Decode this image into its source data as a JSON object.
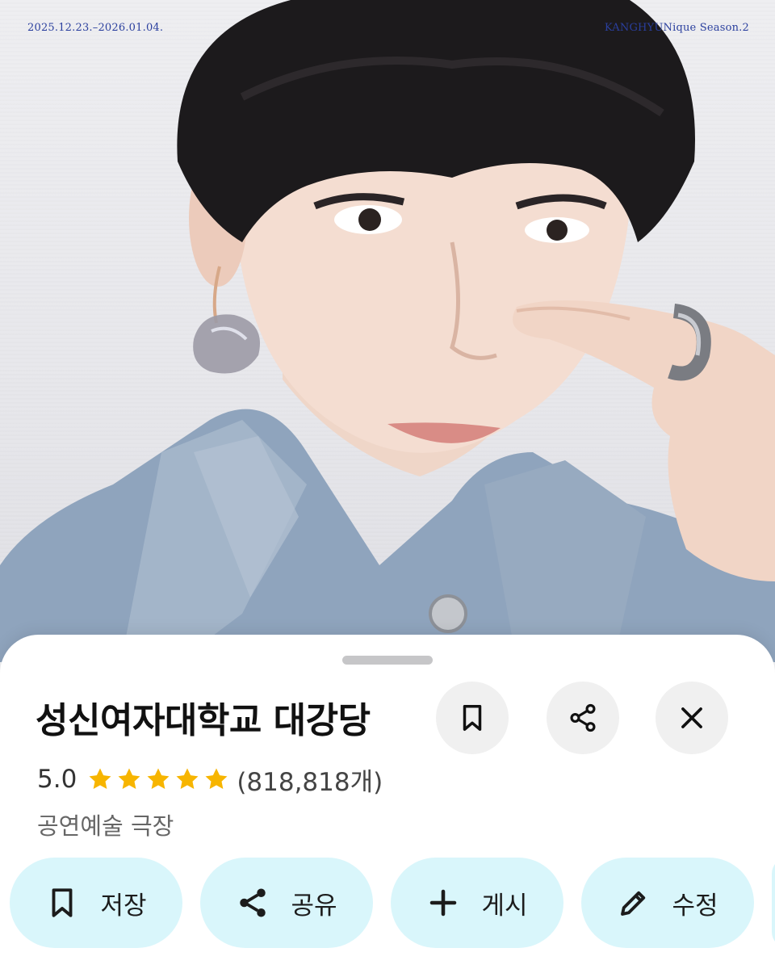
{
  "poster": {
    "date_range": "2025.12.23.–2026.01.04.",
    "series_title": "KANGHYUNique Season.2"
  },
  "place": {
    "title": "성신여자대학교 대강당",
    "rating": "5.0",
    "stars": 5,
    "review_count": "(818,818개)",
    "category": "공연예술 극장"
  },
  "actions": {
    "save": "저장",
    "share": "공유",
    "post": "게시",
    "edit": "수정"
  },
  "icons": {
    "bookmark": "bookmark-icon",
    "share": "share-icon",
    "close": "close-icon",
    "star": "star-icon",
    "plus": "plus-icon",
    "pencil": "pencil-icon"
  },
  "colors": {
    "accent_pill": "#d9f6fb",
    "star": "#f7b500",
    "title_text": "#2a3f9e"
  }
}
